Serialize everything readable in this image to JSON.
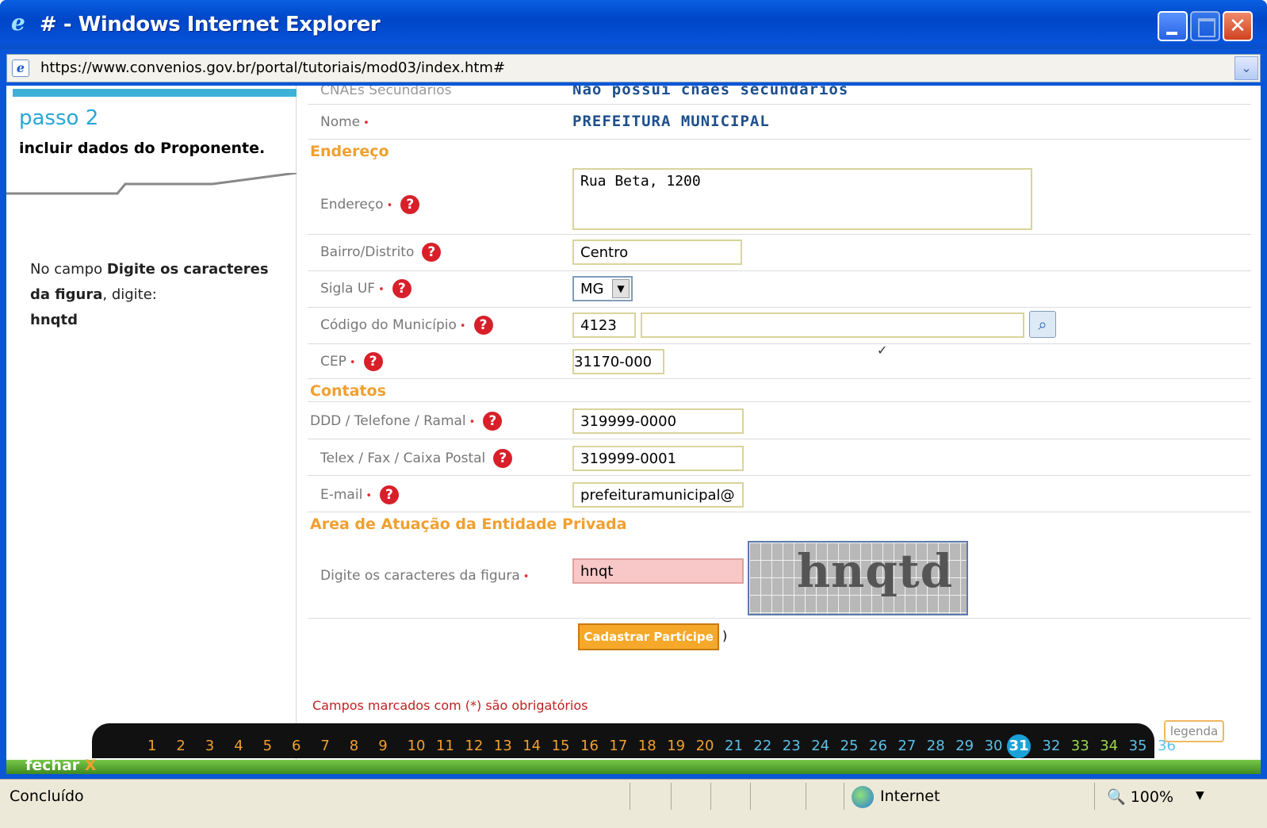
{
  "window": {
    "title": "# - Windows Internet Explorer",
    "address": "https://www.convenios.gov.br/portal/tutoriais/mod03/index.htm#",
    "status": "Concluído",
    "zone": "Internet",
    "zoom": "100%"
  },
  "left": {
    "step": "passo 2",
    "subtitle": "incluir dados do Proponente.",
    "instr_pre": "No campo ",
    "instr_bold1": "Digite os caracteres da figura",
    "instr_mid": ", digite: ",
    "instr_bold2": "hnqtd"
  },
  "form": {
    "partial_row": "CNAEs Secundários",
    "partial_value": "Não possui cnaes secundários",
    "nome_label": "Nome",
    "nome_value": "PREFEITURA MUNICIPAL",
    "sect_endereco": "Endereço",
    "endereco_label": "Endereço",
    "endereco_value": "Rua Beta, 1200",
    "bairro_label": "Bairro/Distrito",
    "bairro_value": "Centro",
    "uf_label": "Sigla UF",
    "uf_value": "MG",
    "mun_label": "Código do Município",
    "mun_code": "4123",
    "mun_name": "",
    "cep_label": "CEP",
    "cep_value": "31170-000",
    "sect_contatos": "Contatos",
    "tel_label": "DDD / Telefone / Ramal",
    "tel_value": "319999-0000",
    "fax_label": "Telex / Fax / Caixa Postal",
    "fax_value": "319999-0001",
    "email_label": "E-mail",
    "email_value": "prefeituramunicipal@",
    "sect_area": "Area de Atuação da Entidade Privada",
    "captcha_label": "Digite os caracteres da figura",
    "captcha_value": "hnqt",
    "captcha_image_text": "hnqtd",
    "submit": "Cadastrar Partícipe",
    "submit_paren": ")",
    "required_note": "Campos marcados com (*) são obrigatórios",
    "check": "✓"
  },
  "nav": {
    "pages": [
      "1",
      "2",
      "3",
      "4",
      "5",
      "6",
      "7",
      "8",
      "9",
      "10",
      "11",
      "12",
      "13",
      "14",
      "15",
      "16",
      "17",
      "18",
      "19",
      "20",
      "21",
      "22",
      "23",
      "24",
      "25",
      "26",
      "27",
      "28",
      "29",
      "30",
      "31",
      "32",
      "33",
      "34",
      "35",
      "36"
    ],
    "current": "31",
    "fechar": "fechar",
    "fechar_x": "X",
    "legenda": "legenda"
  },
  "colors": {
    "orange": "#f0a030",
    "blue": "#1aa2d8",
    "green_pages": "#9ad84a"
  }
}
